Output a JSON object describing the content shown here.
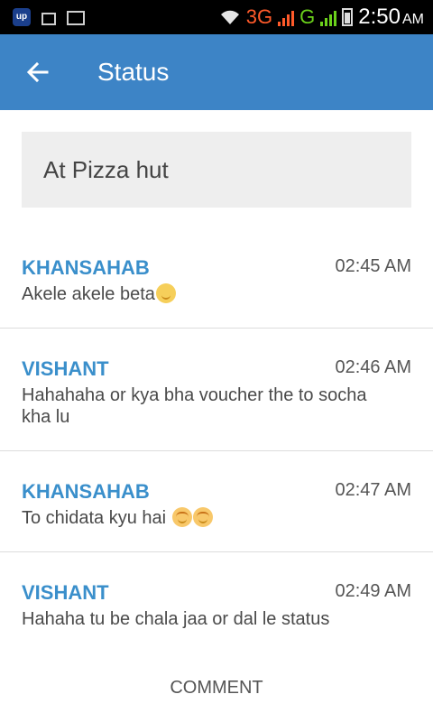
{
  "status_bar": {
    "app_badge": "up",
    "network_3g": "3G",
    "network_g": "G",
    "time": "2:50",
    "ampm": "AM",
    "colors": {
      "network_3g": "#ff5a2a",
      "network_g": "#6bd11b"
    }
  },
  "appbar": {
    "title": "Status",
    "back_icon": "arrow-left-icon",
    "color": "#3d84c6"
  },
  "status_text": "At Pizza hut",
  "comments": [
    {
      "name": "KHANSAHAB",
      "time": "02:45 AM",
      "text": "Akele akele beta",
      "emojis": [
        "smile"
      ]
    },
    {
      "name": "VISHANT",
      "time": "02:46 AM",
      "text": "Hahahaha or kya bha voucher the to socha kha lu",
      "emojis": []
    },
    {
      "name": "KHANSAHAB",
      "time": "02:47 AM",
      "text": "To chidata kyu hai ",
      "emojis": [
        "laugh",
        "laugh"
      ]
    },
    {
      "name": "VISHANT",
      "time": "02:49 AM",
      "text": "Hahaha tu be chala jaa or dal le status",
      "emojis": []
    }
  ],
  "comment_button": "COMMENT"
}
